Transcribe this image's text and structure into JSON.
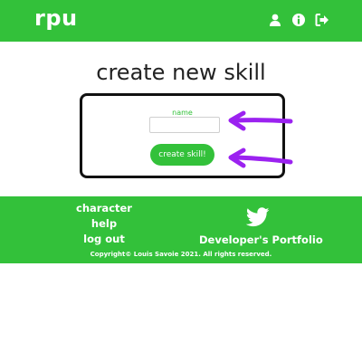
{
  "header": {
    "logo": "rpu",
    "icons": [
      "user-icon",
      "info-icon",
      "logout-icon"
    ]
  },
  "main": {
    "title": "create new skill",
    "form": {
      "name_label": "name",
      "name_value": "",
      "button_label": "create skill!"
    }
  },
  "footer": {
    "links": [
      "character",
      "help",
      "log out"
    ],
    "social_icon": "twitter-icon",
    "portfolio_label": "Developer's Portfolio",
    "copyright": "Copyright© Louis Savoie 2021. All rights reserved."
  },
  "colors": {
    "brand_green": "#33c13a",
    "annotation_arrow": "#9b22f0"
  }
}
